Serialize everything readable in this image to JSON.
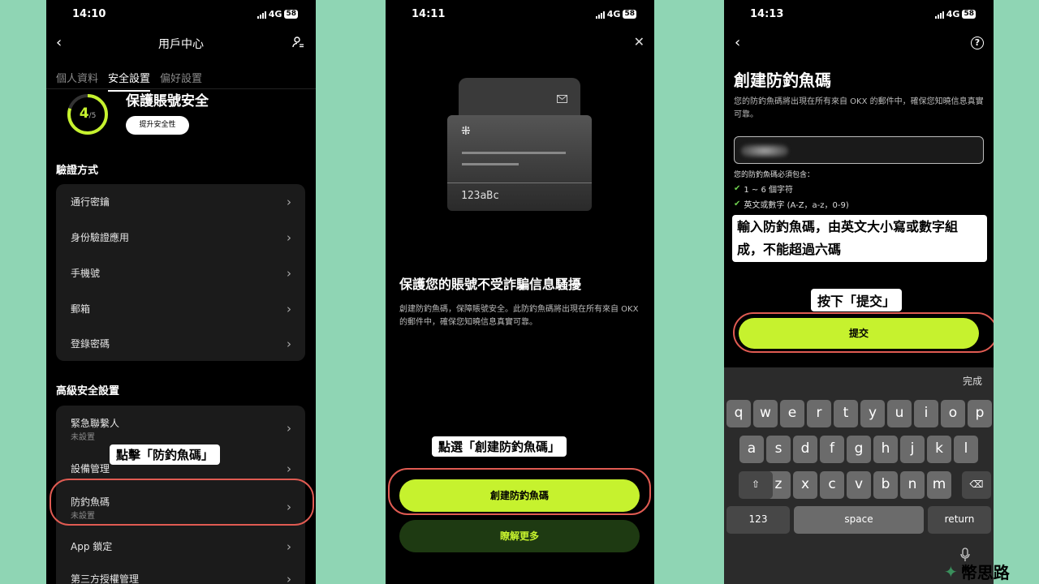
{
  "colors": {
    "accent": "#c6f22e",
    "background": "#8fd5b4",
    "highlight": "#e05b52"
  },
  "phone1": {
    "status": {
      "time": "14:10",
      "network": "4G",
      "battery": "58"
    },
    "title": "用戶中心",
    "tabs": [
      "個人資料",
      "安全設置",
      "偏好設置"
    ],
    "progress": {
      "score": "4",
      "total": "/5",
      "fraction": 0.8
    },
    "security_title": "保護賬號安全",
    "improve_button": "提升安全性",
    "verify_section": "驗證方式",
    "verify_items": [
      "通行密鑰",
      "身份驗證應用",
      "手機號",
      "郵箱",
      "登錄密碼"
    ],
    "advanced_section": "高級安全設置",
    "advanced_items": [
      {
        "label": "緊急聯繫人",
        "sub": "未設置"
      },
      {
        "label": "設備管理",
        "sub": ""
      },
      {
        "label": "防釣魚碼",
        "sub": "未設置"
      },
      {
        "label": "App 鎖定",
        "sub": ""
      },
      {
        "label": "第三方授權管理",
        "sub": ""
      }
    ],
    "callout": "點擊「防釣魚碼」"
  },
  "phone2": {
    "status": {
      "time": "14:11",
      "network": "4G",
      "battery": "58"
    },
    "card_code": "123aBc",
    "heading": "保護您的賬號不受詐騙信息騷擾",
    "description": "創建防釣魚碼，保障賬號安全。此防釣魚碼將出現在所有來自 OKX 的郵件中，確保您知曉信息真實可靠。",
    "callout": "點選「創建防釣魚碼」",
    "primary_button": "創建防釣魚碼",
    "secondary_button": "瞭解更多"
  },
  "phone3": {
    "status": {
      "time": "14:13",
      "network": "4G",
      "battery": "58"
    },
    "heading": "創建防釣魚碼",
    "description": "您的防釣魚碼將出現在所有來自 OKX 的郵件中，確保您知曉信息真實可靠。",
    "requirements_title": "您的防釣魚碼必須包含：",
    "requirements": [
      "1 ~ 6 個字符",
      "英文或數字 (A-Z，a-z，0-9)"
    ],
    "callout_input": "輸入防釣魚碼，由英文大小寫或數字組成，不能超過六碼",
    "callout_submit": "按下「提交」",
    "submit_button": "提交",
    "done_label": "完成",
    "keyboard": {
      "row1": [
        "q",
        "w",
        "e",
        "r",
        "t",
        "y",
        "u",
        "i",
        "o",
        "p"
      ],
      "row2": [
        "a",
        "s",
        "d",
        "f",
        "g",
        "h",
        "j",
        "k",
        "l"
      ],
      "row3": [
        "z",
        "x",
        "c",
        "v",
        "b",
        "n",
        "m"
      ],
      "num_key": "123",
      "space_key": "space",
      "return_key": "return"
    }
  },
  "watermark": "幣思路"
}
